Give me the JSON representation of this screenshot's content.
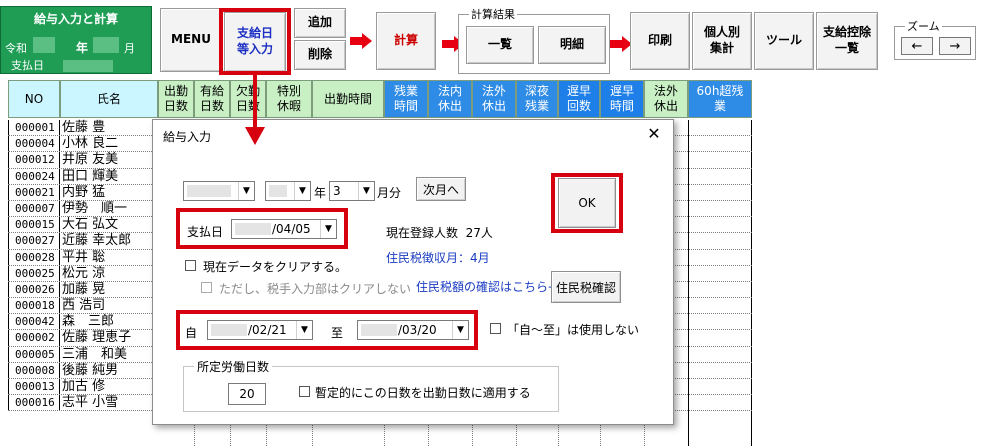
{
  "title_box": {
    "title": "給与入力と計算",
    "era": "令和",
    "year_suffix": "年",
    "month_suffix": "月",
    "payday_label": "支払日"
  },
  "toolbar": {
    "menu": "MENU",
    "salary_input": "支給日\n等入力",
    "add": "追加",
    "delete": "削除",
    "calc": "計算",
    "calc_result_caption": "計算結果",
    "list": "一覧",
    "detail": "明細",
    "print": "印刷",
    "individual_total": "個人別\n集計",
    "tools": "ツール",
    "deduction_list": "支給控除\n一覧",
    "zoom_caption": "ズーム",
    "zoom_out": "←",
    "zoom_in": "→"
  },
  "headers": {
    "no": "NO",
    "name": "氏名",
    "cols": [
      "出勤\n日数",
      "有給\n日数",
      "欠勤\n日数",
      "特別\n休暇",
      "出勤時間",
      "残業\n時間",
      "法内\n休出",
      "法外\n休出",
      "深夜\n残業",
      "遅早\n回数",
      "遅早\n時間",
      "法外\n休出",
      "60h超残\n業"
    ]
  },
  "employees": [
    {
      "no": "000001",
      "name": "佐藤 豊"
    },
    {
      "no": "000004",
      "name": "小林 良二"
    },
    {
      "no": "000012",
      "name": "井原 友美"
    },
    {
      "no": "000024",
      "name": "田口 輝美"
    },
    {
      "no": "000021",
      "name": "内野 猛"
    },
    {
      "no": "000007",
      "name": "伊勢　順一"
    },
    {
      "no": "000015",
      "name": "大石 弘文"
    },
    {
      "no": "000027",
      "name": "近藤 幸太郎"
    },
    {
      "no": "000028",
      "name": "平井 聡"
    },
    {
      "no": "000025",
      "name": "松元 涼"
    },
    {
      "no": "000026",
      "name": "加藤 晃"
    },
    {
      "no": "000018",
      "name": "西 浩司"
    },
    {
      "no": "000042",
      "name": "森　三郎"
    },
    {
      "no": "000002",
      "name": "佐藤 理恵子"
    },
    {
      "no": "000005",
      "name": "三浦　和美"
    },
    {
      "no": "000008",
      "name": "後藤 純男"
    },
    {
      "no": "000013",
      "name": "加古 修"
    },
    {
      "no": "000016",
      "name": "志平 小雪"
    }
  ],
  "dialog": {
    "title": "給与入力",
    "close": "✕",
    "year_suffix": "年",
    "month_value": "3",
    "month_suffix": "月分",
    "next_month": "次月へ",
    "ok": "OK",
    "payday_label": "支払日",
    "payday_value": "/04/05",
    "registered_label": "現在登録人数",
    "registered_value": "27人",
    "resident_tax_month": "住民税徴収月：4月",
    "clear_data": "現在データをクリアする。",
    "clear_note": "ただし、税手入力部はクリアしない",
    "resident_tax_link": "住民税額の確認はこちら→",
    "resident_tax_button": "住民税確認",
    "from_label": "自",
    "from_value": "/02/21",
    "to_label": "至",
    "to_value": "/03/20",
    "range_unused": "「自～至」は使用しない",
    "workdays_caption": "所定労働日数",
    "workdays_value": "20",
    "workdays_apply": "暫定的にこの日数を出勤日数に適用する"
  }
}
